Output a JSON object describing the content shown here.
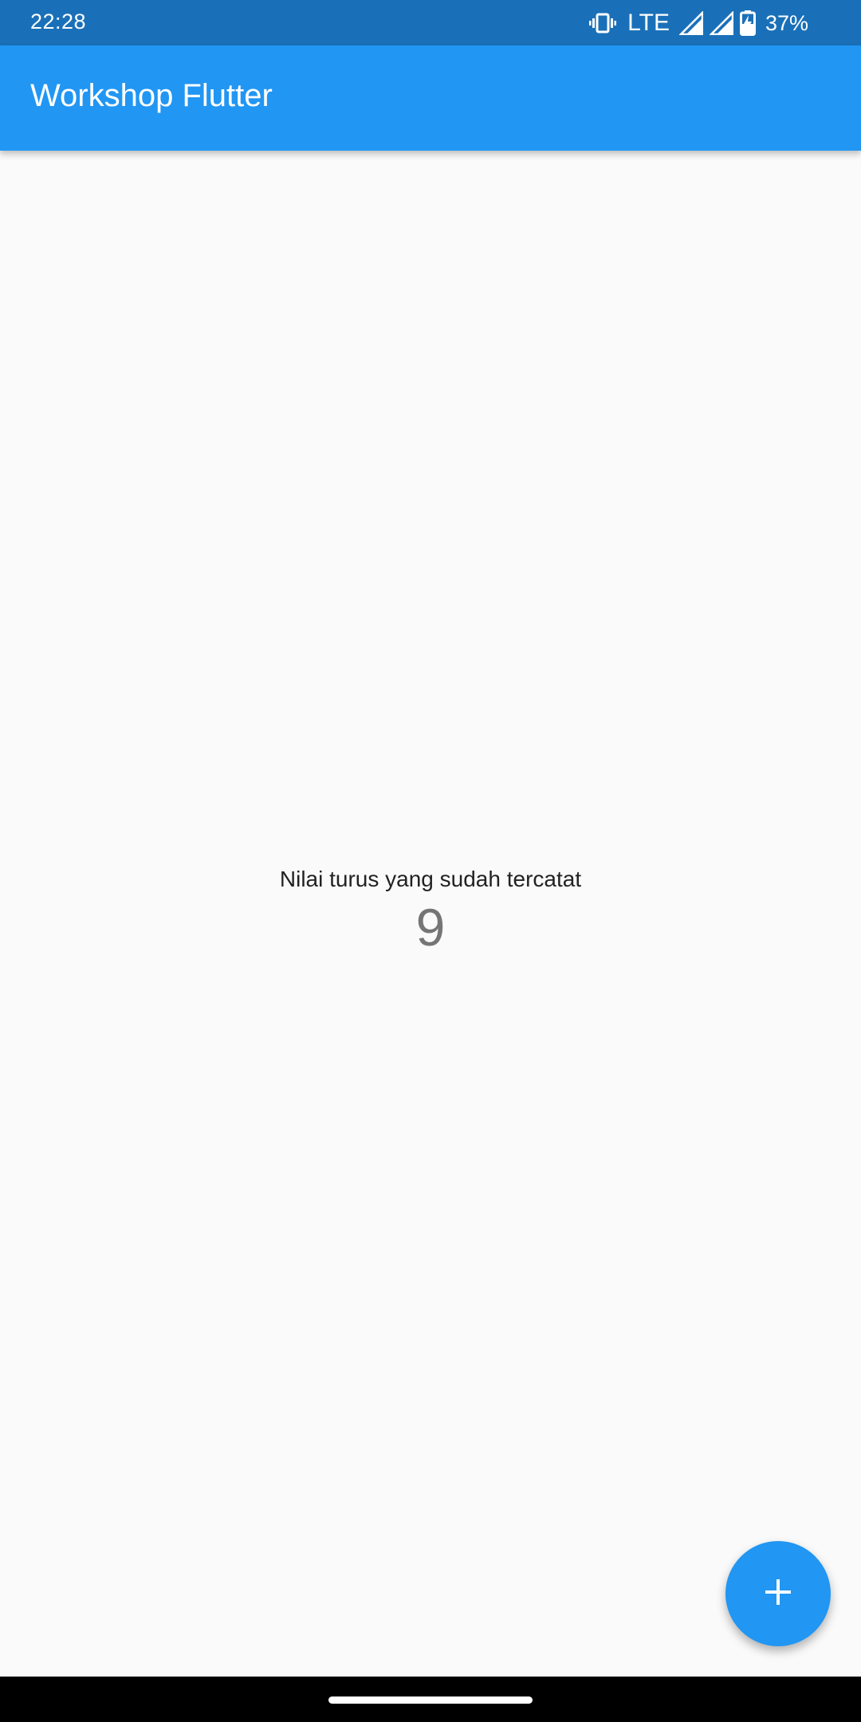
{
  "status_bar": {
    "time": "22:28",
    "network": "LTE",
    "battery_percent": "37%",
    "icons": [
      "vibrate-icon",
      "signal-icon",
      "signal-icon",
      "battery-charging-icon"
    ]
  },
  "app_bar": {
    "title": "Workshop Flutter"
  },
  "main": {
    "counter_label": "Nilai turus yang sudah tercatat",
    "counter_value": "9"
  },
  "fab": {
    "icon": "add-icon"
  },
  "colors": {
    "status_bar": "#1a70b8",
    "primary": "#2196f3",
    "background": "#fafafa",
    "counter_text": "#757575"
  }
}
